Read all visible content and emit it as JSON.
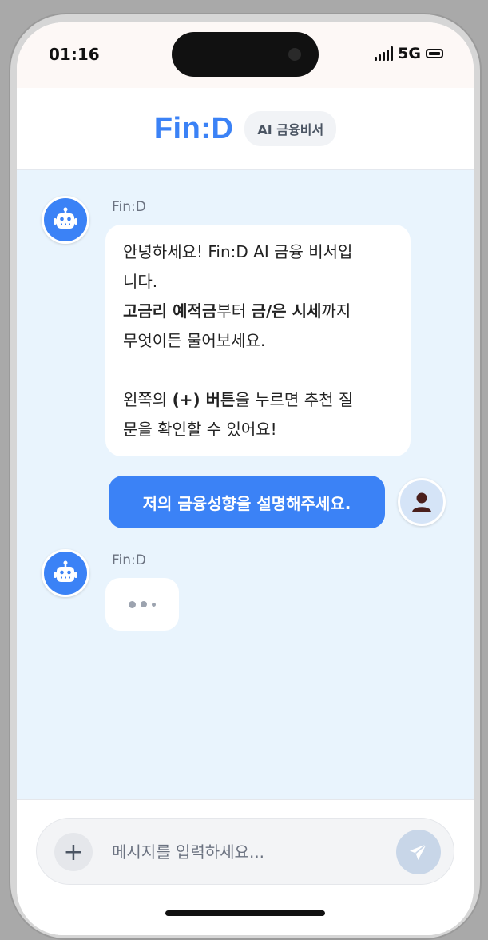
{
  "status_bar": {
    "time": "01:16",
    "network": "5G"
  },
  "header": {
    "brand": "Fin:D",
    "badge": "AI 금융비서"
  },
  "messages": [
    {
      "role": "bot",
      "sender": "Fin:D",
      "lines": [
        [
          {
            "t": "안녕하세요! Fin:D AI 금융 비서입"
          }
        ],
        [
          {
            "t": "니다."
          }
        ],
        [
          {
            "t": "고금리 예적금",
            "b": true
          },
          {
            "t": "부터 "
          },
          {
            "t": "금/은 시세",
            "b": true
          },
          {
            "t": "까지"
          }
        ],
        [
          {
            "t": "무엇이든 물어보세요."
          }
        ],
        [],
        [
          {
            "t": "왼쪽의 "
          },
          {
            "t": "(+) 버튼",
            "b": true
          },
          {
            "t": "을 누르면 추천 질"
          }
        ],
        [
          {
            "t": "문을 확인할 수 있어요!"
          }
        ]
      ]
    },
    {
      "role": "user",
      "text": "저의 금융성향을 설명해주세요."
    },
    {
      "role": "bot",
      "sender": "Fin:D",
      "typing": true
    }
  ],
  "input": {
    "placeholder": "메시지를 입력하세요...",
    "value": "",
    "plus_label": "+"
  },
  "icons": {
    "bot_avatar": "robot-icon",
    "user_avatar": "person-icon",
    "send": "paper-plane-icon"
  },
  "colors": {
    "accent": "#3b82f6",
    "chat_bg": "#e9f4fd",
    "user_avatar_bg": "#d5e4f7",
    "send_disabled": "#c8d6e8"
  }
}
